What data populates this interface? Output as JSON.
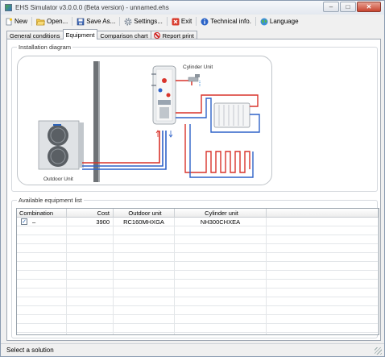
{
  "window": {
    "title": "EHS Simulator v3.0.0.0 (Beta version) - unnamed.ehs",
    "minimize_glyph": "–",
    "maximize_glyph": "□",
    "close_glyph": "✕"
  },
  "toolbar": {
    "items": [
      {
        "label": "New",
        "icon": "new-document-icon"
      },
      {
        "label": "Open...",
        "icon": "open-folder-icon"
      },
      {
        "label": "Save As...",
        "icon": "save-icon"
      },
      {
        "label": "Settings...",
        "icon": "gear-icon"
      },
      {
        "label": "Exit",
        "icon": "exit-icon"
      },
      {
        "label": "Technical info.",
        "icon": "info-icon"
      },
      {
        "label": "Language",
        "icon": "globe-icon"
      }
    ]
  },
  "tabs": [
    {
      "label": "General conditions",
      "active": false
    },
    {
      "label": "Equipment",
      "active": true
    },
    {
      "label": "Comparison chart",
      "active": false
    },
    {
      "label": "Report print",
      "active": false,
      "icon": "no-entry-icon"
    }
  ],
  "installation": {
    "group_title": "Installation diagram",
    "cylinder_label": "Cylinder Unit",
    "outdoor_label": "Outdoor Unit"
  },
  "equipment_list": {
    "group_title": "Available equipment list",
    "columns": [
      "Combination",
      "Cost",
      "Outdoor unit",
      "Cylinder unit",
      ""
    ],
    "rows": [
      {
        "checked": true,
        "combination": "–",
        "cost": "3900",
        "outdoor_unit": "RC160MHXGA",
        "cylinder_unit": "NH300CHXEA"
      }
    ]
  },
  "status": {
    "text": "Select a solution"
  },
  "colors": {
    "hot_pipe": "#d9342b",
    "cold_pipe": "#2f62c8",
    "window_border": "#8a9bb0"
  }
}
